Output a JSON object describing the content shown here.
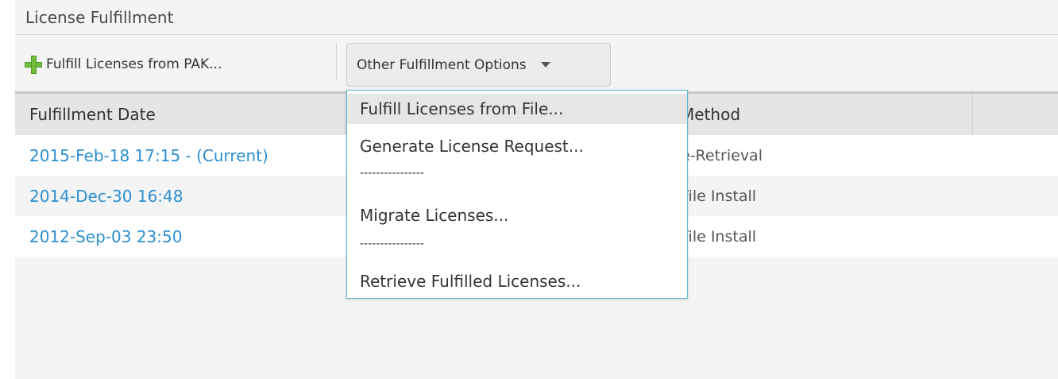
{
  "panel": {
    "title": "License Fulfillment"
  },
  "toolbar": {
    "pak_label": "Fulfill Licenses from PAK...",
    "pak_icon": "plus-icon",
    "other_label": "Other Fulfillment Options",
    "other_icon": "caret-down-icon"
  },
  "grid": {
    "columns": [
      "Fulfillment Date",
      "Method"
    ],
    "rows": [
      {
        "date": "2015-Feb-18 17:15 - (Current)",
        "method": "e-Retrieval"
      },
      {
        "date": "2014-Dec-30 16:48",
        "method": "File Install"
      },
      {
        "date": "2012-Sep-03 23:50",
        "method": "File Install"
      }
    ]
  },
  "menu": {
    "items": [
      "Fulfill Licenses from File...",
      "Generate License Request...",
      "Migrate Licenses...",
      "Retrieve Fulfilled Licenses..."
    ],
    "separator": "----------------",
    "highlighted": "Fulfill Licenses from File..."
  },
  "colors": {
    "link": "#2b8fd0",
    "menu_border": "#5bb8d4",
    "plus_icon": "#6fbf3b"
  }
}
